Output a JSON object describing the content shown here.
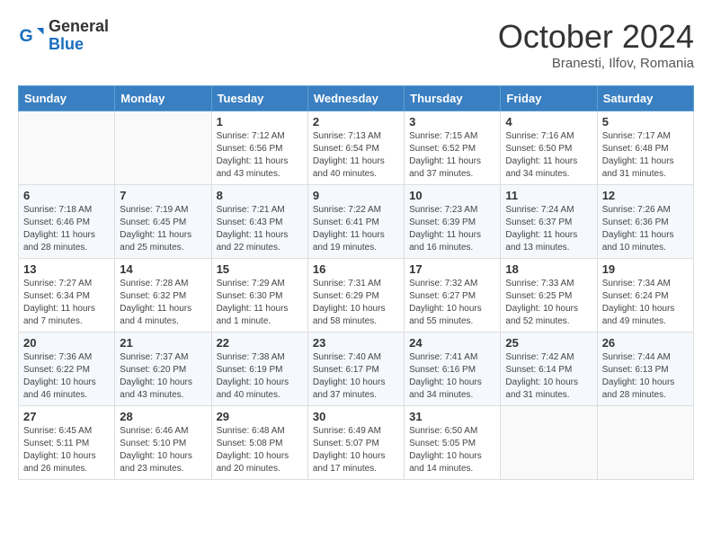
{
  "header": {
    "logo_general": "General",
    "logo_blue": "Blue",
    "month_title": "October 2024",
    "subtitle": "Branesti, Ilfov, Romania"
  },
  "weekdays": [
    "Sunday",
    "Monday",
    "Tuesday",
    "Wednesday",
    "Thursday",
    "Friday",
    "Saturday"
  ],
  "weeks": [
    [
      {
        "day": "",
        "info": ""
      },
      {
        "day": "",
        "info": ""
      },
      {
        "day": "1",
        "info": "Sunrise: 7:12 AM\nSunset: 6:56 PM\nDaylight: 11 hours and 43 minutes."
      },
      {
        "day": "2",
        "info": "Sunrise: 7:13 AM\nSunset: 6:54 PM\nDaylight: 11 hours and 40 minutes."
      },
      {
        "day": "3",
        "info": "Sunrise: 7:15 AM\nSunset: 6:52 PM\nDaylight: 11 hours and 37 minutes."
      },
      {
        "day": "4",
        "info": "Sunrise: 7:16 AM\nSunset: 6:50 PM\nDaylight: 11 hours and 34 minutes."
      },
      {
        "day": "5",
        "info": "Sunrise: 7:17 AM\nSunset: 6:48 PM\nDaylight: 11 hours and 31 minutes."
      }
    ],
    [
      {
        "day": "6",
        "info": "Sunrise: 7:18 AM\nSunset: 6:46 PM\nDaylight: 11 hours and 28 minutes."
      },
      {
        "day": "7",
        "info": "Sunrise: 7:19 AM\nSunset: 6:45 PM\nDaylight: 11 hours and 25 minutes."
      },
      {
        "day": "8",
        "info": "Sunrise: 7:21 AM\nSunset: 6:43 PM\nDaylight: 11 hours and 22 minutes."
      },
      {
        "day": "9",
        "info": "Sunrise: 7:22 AM\nSunset: 6:41 PM\nDaylight: 11 hours and 19 minutes."
      },
      {
        "day": "10",
        "info": "Sunrise: 7:23 AM\nSunset: 6:39 PM\nDaylight: 11 hours and 16 minutes."
      },
      {
        "day": "11",
        "info": "Sunrise: 7:24 AM\nSunset: 6:37 PM\nDaylight: 11 hours and 13 minutes."
      },
      {
        "day": "12",
        "info": "Sunrise: 7:26 AM\nSunset: 6:36 PM\nDaylight: 11 hours and 10 minutes."
      }
    ],
    [
      {
        "day": "13",
        "info": "Sunrise: 7:27 AM\nSunset: 6:34 PM\nDaylight: 11 hours and 7 minutes."
      },
      {
        "day": "14",
        "info": "Sunrise: 7:28 AM\nSunset: 6:32 PM\nDaylight: 11 hours and 4 minutes."
      },
      {
        "day": "15",
        "info": "Sunrise: 7:29 AM\nSunset: 6:30 PM\nDaylight: 11 hours and 1 minute."
      },
      {
        "day": "16",
        "info": "Sunrise: 7:31 AM\nSunset: 6:29 PM\nDaylight: 10 hours and 58 minutes."
      },
      {
        "day": "17",
        "info": "Sunrise: 7:32 AM\nSunset: 6:27 PM\nDaylight: 10 hours and 55 minutes."
      },
      {
        "day": "18",
        "info": "Sunrise: 7:33 AM\nSunset: 6:25 PM\nDaylight: 10 hours and 52 minutes."
      },
      {
        "day": "19",
        "info": "Sunrise: 7:34 AM\nSunset: 6:24 PM\nDaylight: 10 hours and 49 minutes."
      }
    ],
    [
      {
        "day": "20",
        "info": "Sunrise: 7:36 AM\nSunset: 6:22 PM\nDaylight: 10 hours and 46 minutes."
      },
      {
        "day": "21",
        "info": "Sunrise: 7:37 AM\nSunset: 6:20 PM\nDaylight: 10 hours and 43 minutes."
      },
      {
        "day": "22",
        "info": "Sunrise: 7:38 AM\nSunset: 6:19 PM\nDaylight: 10 hours and 40 minutes."
      },
      {
        "day": "23",
        "info": "Sunrise: 7:40 AM\nSunset: 6:17 PM\nDaylight: 10 hours and 37 minutes."
      },
      {
        "day": "24",
        "info": "Sunrise: 7:41 AM\nSunset: 6:16 PM\nDaylight: 10 hours and 34 minutes."
      },
      {
        "day": "25",
        "info": "Sunrise: 7:42 AM\nSunset: 6:14 PM\nDaylight: 10 hours and 31 minutes."
      },
      {
        "day": "26",
        "info": "Sunrise: 7:44 AM\nSunset: 6:13 PM\nDaylight: 10 hours and 28 minutes."
      }
    ],
    [
      {
        "day": "27",
        "info": "Sunrise: 6:45 AM\nSunset: 5:11 PM\nDaylight: 10 hours and 26 minutes."
      },
      {
        "day": "28",
        "info": "Sunrise: 6:46 AM\nSunset: 5:10 PM\nDaylight: 10 hours and 23 minutes."
      },
      {
        "day": "29",
        "info": "Sunrise: 6:48 AM\nSunset: 5:08 PM\nDaylight: 10 hours and 20 minutes."
      },
      {
        "day": "30",
        "info": "Sunrise: 6:49 AM\nSunset: 5:07 PM\nDaylight: 10 hours and 17 minutes."
      },
      {
        "day": "31",
        "info": "Sunrise: 6:50 AM\nSunset: 5:05 PM\nDaylight: 10 hours and 14 minutes."
      },
      {
        "day": "",
        "info": ""
      },
      {
        "day": "",
        "info": ""
      }
    ]
  ]
}
